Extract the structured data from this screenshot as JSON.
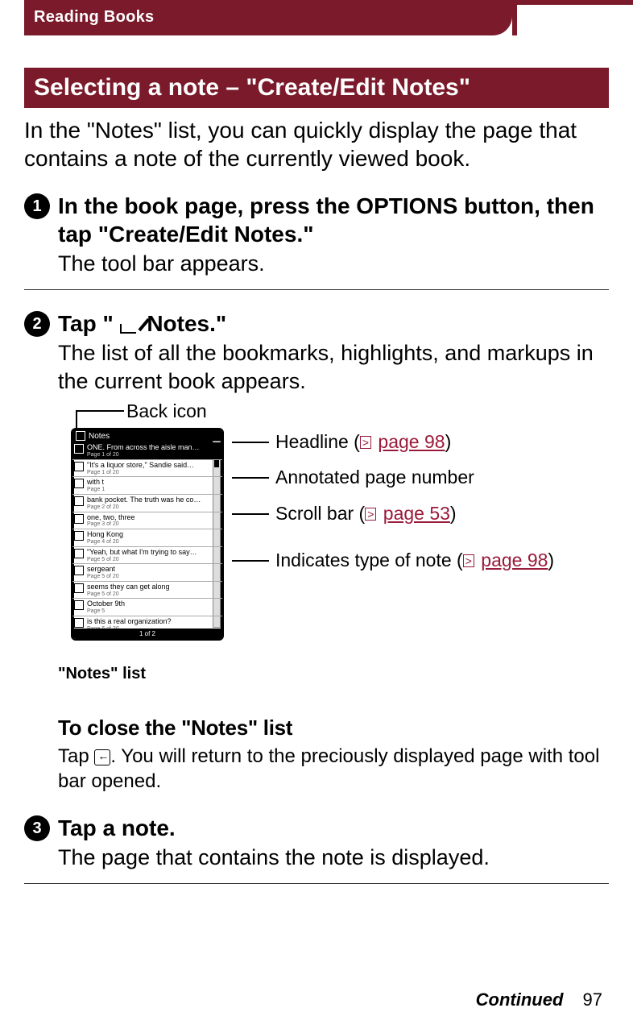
{
  "chapter": "Reading Books",
  "section_title": "Selecting a note – \"Create/Edit Notes\"",
  "intro": "In the \"Notes\" list, you can quickly display the page that contains a note of the currently viewed book.",
  "steps": {
    "s1": {
      "num": "1",
      "title": "In the book page, press the OPTIONS button, then tap \"Create/Edit Notes.\"",
      "desc": "The tool bar appears."
    },
    "s2": {
      "num": "2",
      "title_before": "Tap \"",
      "title_after": " Notes.\"",
      "desc": "The list of all the bookmarks, highlights, and markups in the current book appears."
    },
    "s3": {
      "num": "3",
      "title": "Tap a note.",
      "desc": "The page that contains the note is displayed."
    }
  },
  "figure": {
    "back_label": "Back icon",
    "callouts": {
      "headline_pre": "Headline (",
      "headline_link": "page 98",
      "headline_post": ")",
      "annotated": "Annotated page number",
      "scroll_pre": "Scroll bar (",
      "scroll_link": "page 53",
      "scroll_post": ")",
      "type_pre": "Indicates type of note (",
      "type_link": "page 98",
      "type_post": ")"
    },
    "caption": "\"Notes\" list",
    "ref_glyph": ">"
  },
  "close": {
    "heading": "To close the \"Notes\" list",
    "text_before": "Tap ",
    "text_after": ". You will return to the preciously displayed page with tool bar opened."
  },
  "footer": {
    "continued": "Continued",
    "page": "97"
  }
}
